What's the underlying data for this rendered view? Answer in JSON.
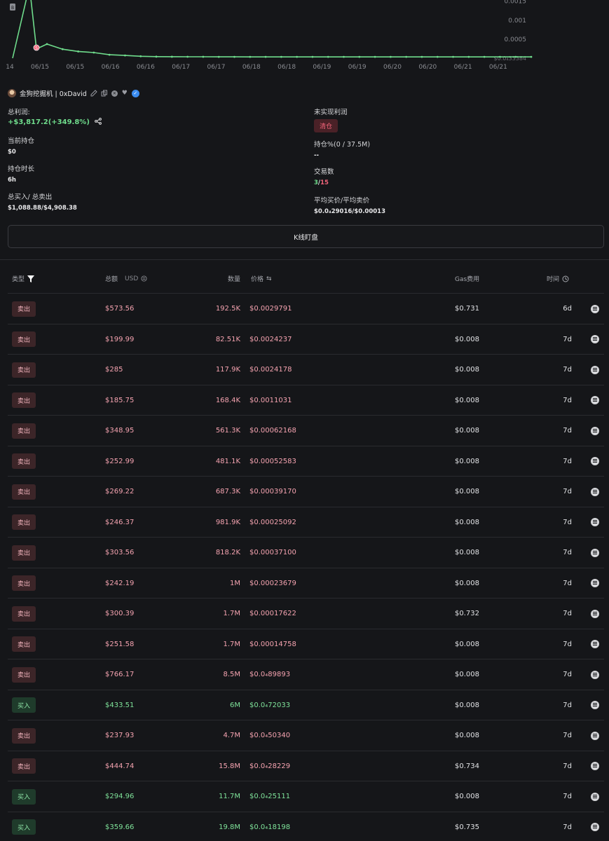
{
  "chart_data": {
    "type": "line",
    "x_ticks": [
      "14",
      "06/15",
      "06/15",
      "06/16",
      "06/16",
      "06/17",
      "06/17",
      "06/18",
      "06/18",
      "06/19",
      "06/19",
      "06/20",
      "06/20",
      "06/21",
      "06/21"
    ],
    "y_ticks": [
      "0.0015",
      "0.001",
      "0.0005"
    ],
    "y_overlap_label": "$0.0₄33384",
    "series": [
      {
        "values": [
          0.0,
          0.0029791,
          0.00024237,
          0.000371,
          0.00023679,
          0.00017622,
          0.00014758,
          8.9893e-05,
          7.2033e-05,
          5.034e-05,
          4e-05,
          3.8e-05,
          3.7e-05,
          3.6e-05,
          3.5e-05,
          3.5e-05,
          3.4e-05,
          3.4e-05,
          3.4e-05,
          3.4e-05,
          3.4e-05,
          3.4e-05,
          3.4e-05,
          3.4e-05,
          3.4e-05,
          3.4e-05,
          3.4e-05,
          3.4e-05,
          3.4e-05,
          3.4e-05,
          3.4e-05,
          3.4e-05,
          3.4e-05,
          3.4e-05,
          3.4e-05
        ]
      }
    ],
    "ylim": [
      0,
      0.0019
    ],
    "grid": false,
    "markers": [
      {
        "label": "S",
        "color": "#f2647a"
      },
      {
        "label": "B",
        "color": "#8b8d93"
      }
    ]
  },
  "colors": {
    "green": "#6fdc8c",
    "red": "#f2647a",
    "bg": "#151619"
  },
  "wallet": {
    "name": "金狗挖掘机 | 0xDavid",
    "icons": [
      "edit-icon",
      "copy-icon",
      "x-icon",
      "heart-icon",
      "verified-icon"
    ]
  },
  "stats": {
    "total_profit_label": "总利润:",
    "total_profit_value": "+$3,817.2(+349.8%)",
    "unrealized_label": "未实现利润",
    "unrealized_badge": "清仓",
    "holding_label": "当前持仓",
    "holding_value": "$0",
    "holding_pct_label": "持仓%(0 / 37.5M)",
    "holding_pct_value": "--",
    "duration_label": "持仓时长",
    "duration_value": "6h",
    "trades_label": "交易数",
    "trades_buy": "3",
    "trades_sep": "/",
    "trades_sell": "15",
    "totals_label": "总买入/ 总卖出",
    "totals_value": "$1,088.88/$4,908.38",
    "avg_label": "平均买价/平均卖价",
    "avg_value": "$0.0₄29016/$0.00013"
  },
  "kline_button": "K线盯盘",
  "table": {
    "headers": {
      "type": "类型",
      "amount": "总额",
      "usd": "USD",
      "qty": "数量",
      "price": "价格",
      "gas": "Gas费用",
      "time": "时间"
    },
    "rows": [
      {
        "type": "卖出",
        "side": "sell",
        "amount": "$573.56",
        "qty": "192.5K",
        "price": "$0.0029791",
        "gas": "$0.731",
        "time": "6d"
      },
      {
        "type": "卖出",
        "side": "sell",
        "amount": "$199.99",
        "qty": "82.51K",
        "price": "$0.0024237",
        "gas": "$0.008",
        "time": "7d"
      },
      {
        "type": "卖出",
        "side": "sell",
        "amount": "$285",
        "qty": "117.9K",
        "price": "$0.0024178",
        "gas": "$0.008",
        "time": "7d"
      },
      {
        "type": "卖出",
        "side": "sell",
        "amount": "$185.75",
        "qty": "168.4K",
        "price": "$0.0011031",
        "gas": "$0.008",
        "time": "7d"
      },
      {
        "type": "卖出",
        "side": "sell",
        "amount": "$348.95",
        "qty": "561.3K",
        "price": "$0.00062168",
        "gas": "$0.008",
        "time": "7d"
      },
      {
        "type": "卖出",
        "side": "sell",
        "amount": "$252.99",
        "qty": "481.1K",
        "price": "$0.00052583",
        "gas": "$0.008",
        "time": "7d"
      },
      {
        "type": "卖出",
        "side": "sell",
        "amount": "$269.22",
        "qty": "687.3K",
        "price": "$0.00039170",
        "gas": "$0.008",
        "time": "7d"
      },
      {
        "type": "卖出",
        "side": "sell",
        "amount": "$246.37",
        "qty": "981.9K",
        "price": "$0.00025092",
        "gas": "$0.008",
        "time": "7d"
      },
      {
        "type": "卖出",
        "side": "sell",
        "amount": "$303.56",
        "qty": "818.2K",
        "price": "$0.00037100",
        "gas": "$0.008",
        "time": "7d"
      },
      {
        "type": "卖出",
        "side": "sell",
        "amount": "$242.19",
        "qty": "1M",
        "price": "$0.00023679",
        "gas": "$0.008",
        "time": "7d"
      },
      {
        "type": "卖出",
        "side": "sell",
        "amount": "$300.39",
        "qty": "1.7M",
        "price": "$0.00017622",
        "gas": "$0.732",
        "time": "7d"
      },
      {
        "type": "卖出",
        "side": "sell",
        "amount": "$251.58",
        "qty": "1.7M",
        "price": "$0.00014758",
        "gas": "$0.008",
        "time": "7d"
      },
      {
        "type": "卖出",
        "side": "sell",
        "amount": "$766.17",
        "qty": "8.5M",
        "price": "$0.0₄89893",
        "gas": "$0.008",
        "time": "7d"
      },
      {
        "type": "买入",
        "side": "buy",
        "amount": "$433.51",
        "qty": "6M",
        "price": "$0.0₄72033",
        "gas": "$0.008",
        "time": "7d"
      },
      {
        "type": "卖出",
        "side": "sell",
        "amount": "$237.93",
        "qty": "4.7M",
        "price": "$0.0₄50340",
        "gas": "$0.008",
        "time": "7d"
      },
      {
        "type": "卖出",
        "side": "sell",
        "amount": "$444.74",
        "qty": "15.8M",
        "price": "$0.0₄28229",
        "gas": "$0.734",
        "time": "7d"
      },
      {
        "type": "买入",
        "side": "buy",
        "amount": "$294.96",
        "qty": "11.7M",
        "price": "$0.0₄25111",
        "gas": "$0.008",
        "time": "7d"
      },
      {
        "type": "买入",
        "side": "buy",
        "amount": "$359.66",
        "qty": "19.8M",
        "price": "$0.0₄18198",
        "gas": "$0.735",
        "time": "7d"
      }
    ]
  }
}
